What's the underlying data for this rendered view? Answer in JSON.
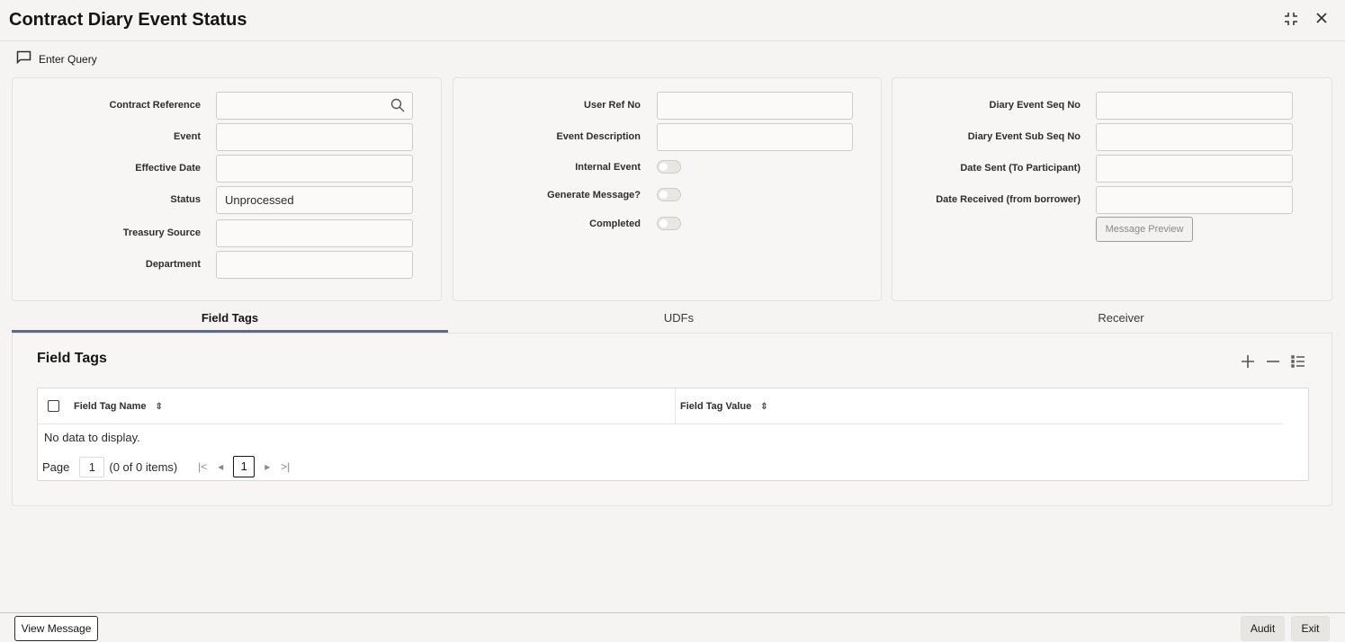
{
  "window": {
    "title": "Contract Diary Event Status",
    "icons": {
      "minimize": "collapse-icon",
      "close": "close-icon"
    }
  },
  "toolbar": {
    "enter_query_label": "Enter Query",
    "icon": "chat-bubble-icon"
  },
  "panel_left": {
    "contract_reference_label": "Contract Reference",
    "contract_reference_value": "",
    "event_label": "Event",
    "event_value": "",
    "effective_date_label": "Effective Date",
    "effective_date_value": "",
    "status_label": "Status",
    "status_value": "Unprocessed",
    "treasury_source_label": "Treasury Source",
    "treasury_source_value": "",
    "department_label": "Department",
    "department_value": ""
  },
  "panel_middle": {
    "user_ref_no_label": "User Ref No",
    "user_ref_no_value": "",
    "event_description_label": "Event Description",
    "event_description_value": "",
    "internal_event_label": "Internal Event",
    "internal_event_on": false,
    "generate_message_label": "Generate Message?",
    "generate_message_on": false,
    "completed_label": "Completed",
    "completed_on": false
  },
  "panel_right": {
    "diary_event_seq_no_label": "Diary Event Seq No",
    "diary_event_seq_no_value": "",
    "diary_event_sub_seq_no_label": "Diary Event Sub Seq No",
    "diary_event_sub_seq_no_value": "",
    "date_sent_label": "Date Sent (To Participant)",
    "date_sent_value": "",
    "date_received_label": "Date Received (from borrower)",
    "date_received_value": "",
    "message_preview_label": "Message Preview"
  },
  "tabs": [
    {
      "label": "Field Tags",
      "active": true
    },
    {
      "label": "UDFs",
      "active": false
    },
    {
      "label": "Receiver",
      "active": false
    }
  ],
  "field_tags": {
    "title": "Field Tags",
    "columns": [
      "Field Tag Name",
      "Field Tag Value"
    ],
    "rows": [],
    "no_data_text": "No data to display.",
    "pager": {
      "page_label": "Page",
      "page_value": "1",
      "items_text": "(0 of 0 items)",
      "current_page": "1"
    }
  },
  "footer": {
    "view_message_label": "View Message",
    "audit_label": "Audit",
    "exit_label": "Exit"
  },
  "colors": {
    "tab_indicator": "#5d6a86",
    "background": "#f5f4f2"
  }
}
